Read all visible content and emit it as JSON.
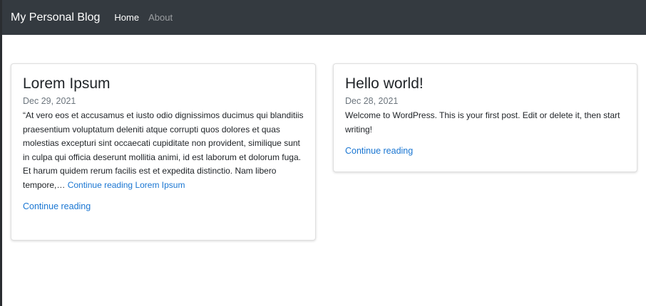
{
  "navbar": {
    "brand": "My Personal Blog",
    "links": [
      {
        "label": "Home",
        "state": "active"
      },
      {
        "label": "About",
        "state": "inactive"
      }
    ]
  },
  "posts": [
    {
      "title": "Lorem Ipsum",
      "date": "Dec 29, 2021",
      "excerpt": "“At vero eos et accusamus et iusto odio dignissimos ducimus qui blanditiis praesentium voluptatum deleniti atque corrupti quos dolores et quas molestias excepturi sint occaecati cupiditate non provident, similique sunt in culpa qui officia deserunt mollitia animi, id est laborum et dolorum fuga. Et harum quidem rerum facilis est et expedita distinctio. Nam libero tempore,…",
      "inline_link": "Continue reading Lorem Ipsum",
      "continue_label": "Continue reading"
    },
    {
      "title": "Hello world!",
      "date": "Dec 28, 2021",
      "excerpt": "Welcome to WordPress. This is your first post. Edit or delete it, then start writing!",
      "continue_label": "Continue reading"
    }
  ],
  "colors": {
    "navbar_bg": "#343a40",
    "link": "#1a76d2",
    "date_text": "#6c757d"
  }
}
